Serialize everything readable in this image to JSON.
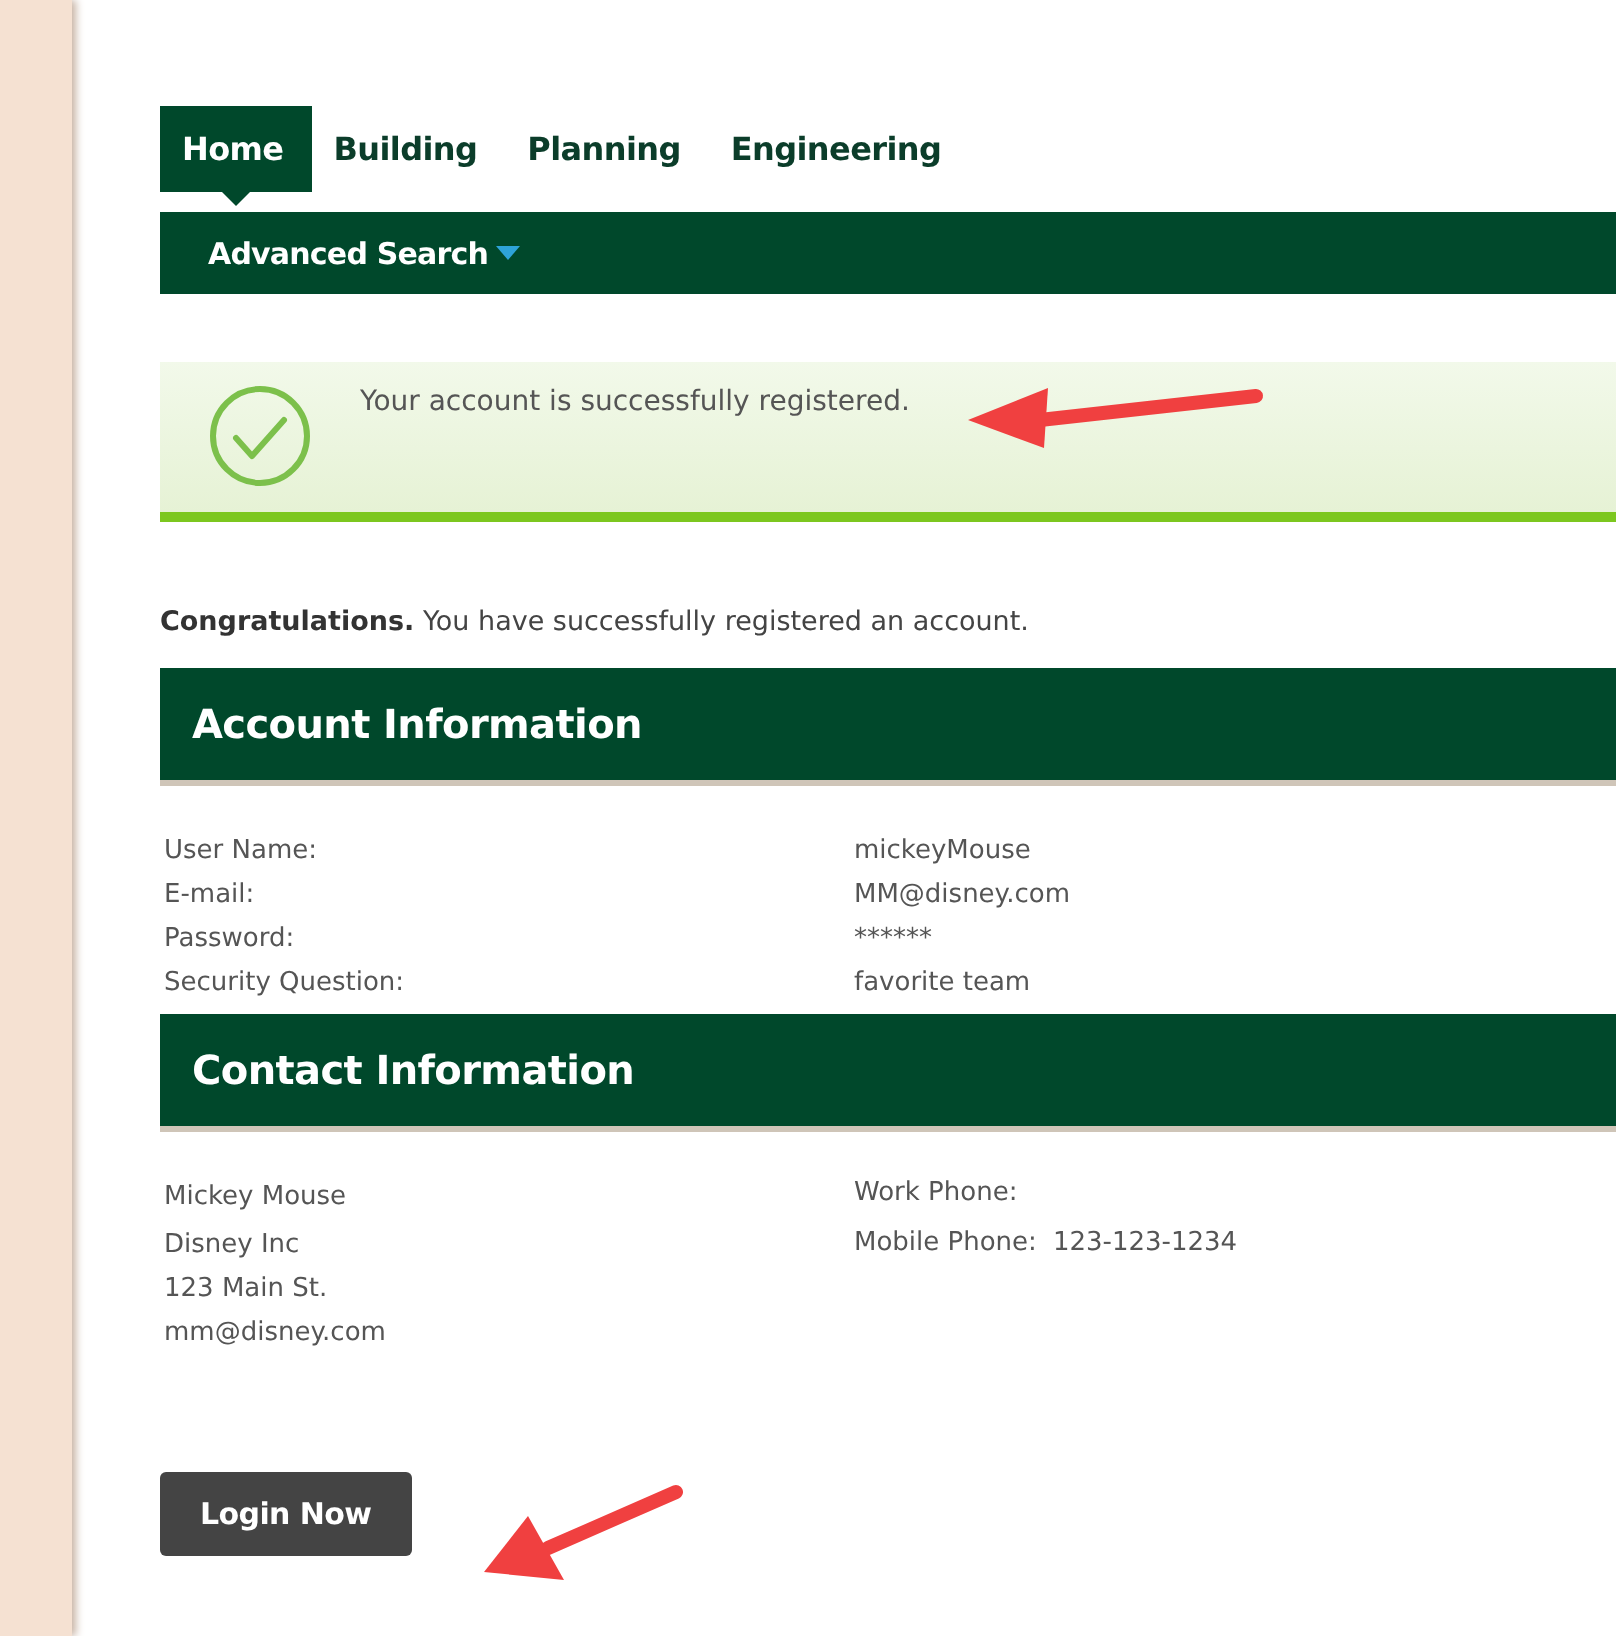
{
  "tabs": [
    {
      "label": "Home",
      "selected": true
    },
    {
      "label": "Building",
      "selected": false
    },
    {
      "label": "Planning",
      "selected": false
    },
    {
      "label": "Engineering",
      "selected": false
    }
  ],
  "subnav": {
    "label": "Advanced Search"
  },
  "notice": {
    "message": "Your account is successfully registered."
  },
  "intro": "**Congratulations.** You have successfully registered an account.",
  "account": {
    "heading": "Account Information",
    "rows": [
      {
        "label": "User Name:",
        "value": "mickeyMouse"
      },
      {
        "label": "E-mail:",
        "value": "MM@disney.com"
      },
      {
        "label": "Password:",
        "value": "******"
      },
      {
        "label": "Security Question:",
        "value": "favorite team"
      }
    ]
  },
  "contact": {
    "heading": "Contact Information",
    "lines": [
      "Mickey Mouse",
      "Disney Inc",
      "123 Main St.",
      "mm@disney.com"
    ],
    "phones": [
      {
        "label": "Work Phone:"
      },
      {
        "label": "Mobile Phone:",
        "value": "123-123-1234"
      }
    ]
  },
  "login_button": "Login Now"
}
